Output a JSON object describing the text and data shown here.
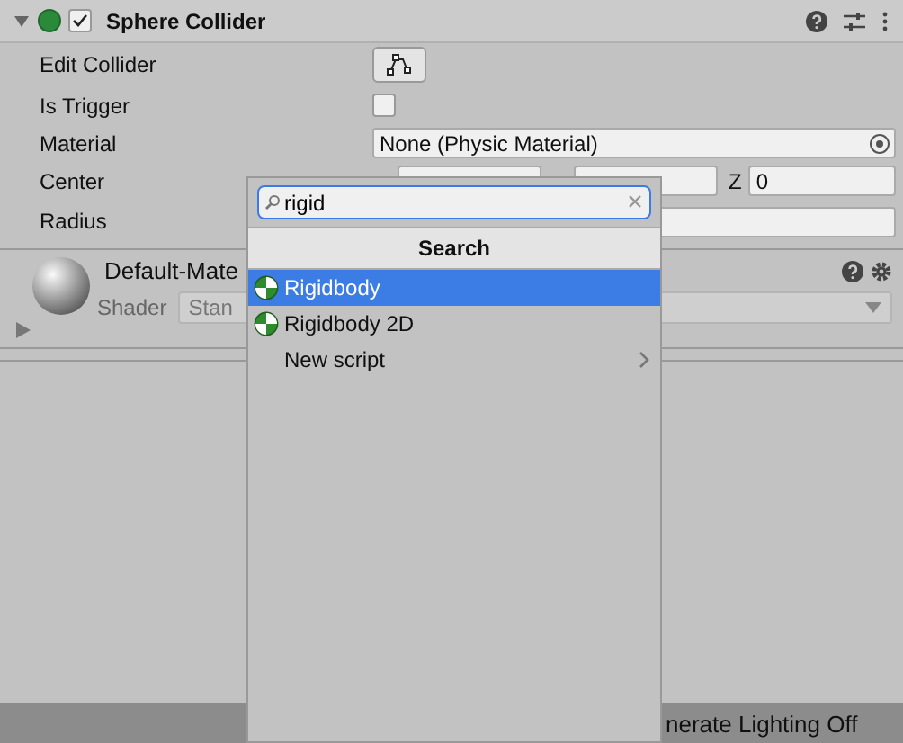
{
  "component": {
    "title": "Sphere Collider",
    "expanded": true,
    "enabled": true,
    "properties": [
      {
        "kind": "button",
        "label": "Edit Collider"
      },
      {
        "kind": "checkbox",
        "label": "Is Trigger",
        "checked": false
      },
      {
        "kind": "object",
        "label": "Material",
        "value": "None (Physic Material)"
      },
      {
        "kind": "vector",
        "label": "Center",
        "z_label": "Z",
        "z_value": "0"
      },
      {
        "kind": "number",
        "label": "Radius"
      }
    ]
  },
  "material": {
    "name": "Default-Mate",
    "shader_label": "Shader",
    "shader_value": "Stan"
  },
  "popup": {
    "search": {
      "value": "rigid"
    },
    "header": "Search",
    "items": [
      {
        "label": "Rigidbody",
        "icon": true,
        "submenu": false,
        "selected": true
      },
      {
        "label": "Rigidbody 2D",
        "icon": true,
        "submenu": false,
        "selected": false
      },
      {
        "label": "New script",
        "icon": false,
        "submenu": true,
        "selected": false
      }
    ]
  },
  "status_bar": {
    "text": "nerate Lighting Off"
  }
}
